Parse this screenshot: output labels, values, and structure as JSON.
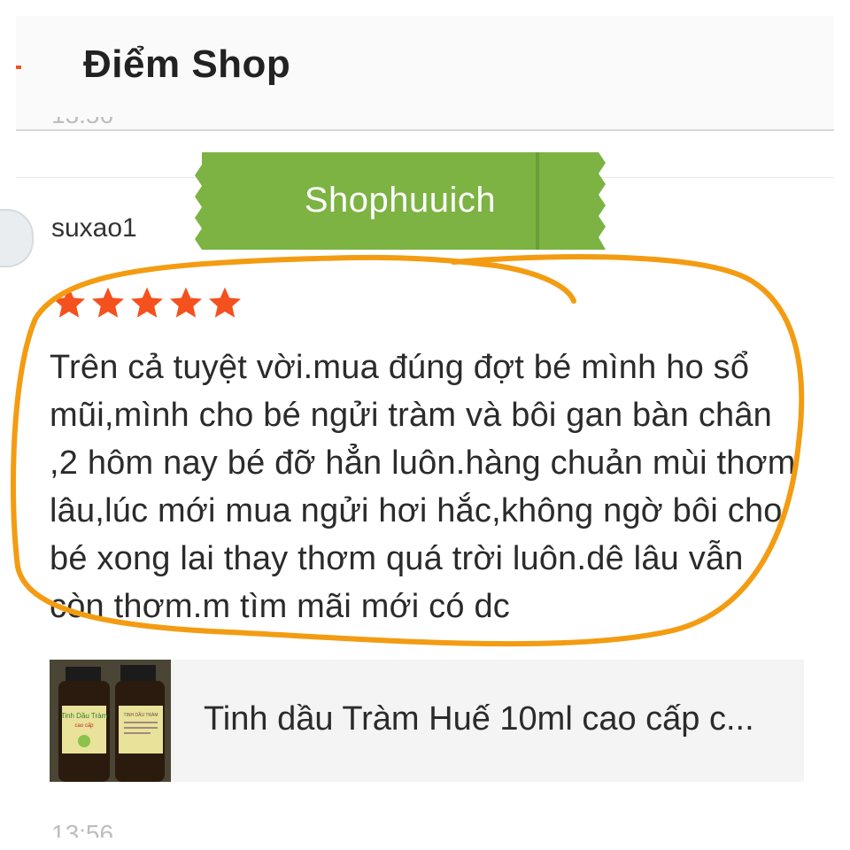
{
  "header": {
    "title": "Điểm Shop",
    "back_icon": "back-arrow-icon"
  },
  "previous_message": {
    "time": "13:56"
  },
  "watermark": {
    "text": "Shophuuich",
    "color": "#7cb342"
  },
  "review": {
    "username": "suxao1",
    "rating": 5,
    "max_rating": 5,
    "star_color": "#f4511e",
    "lines": [
      "Trên cả tuyệt vời.mua đúng đợt bé mình ho sổ",
      "mũi,mình cho bé ngửi tràm và bôi gan bàn chân",
      ",2 hôm nay bé đỡ hẳn luôn.hàng chuản mùi thơm",
      "lâu,lúc mới mua ngửi hơi hắc,không ngờ bôi cho",
      "bé xong lai thay thơm quá trời luôn.dê lâu vẫn",
      "còn thơm.m tìm mãi mới có dc"
    ],
    "highlight_color": "#f39c12"
  },
  "product": {
    "name": "Tinh dầu Tràm Huế 10ml cao cấp c...",
    "label_lines": [
      "Tinh Dầu Tràm",
      "cao cấp"
    ],
    "label_small_text": "TINH DẦU TRÀM"
  },
  "next_message": {
    "time": "13:56"
  }
}
